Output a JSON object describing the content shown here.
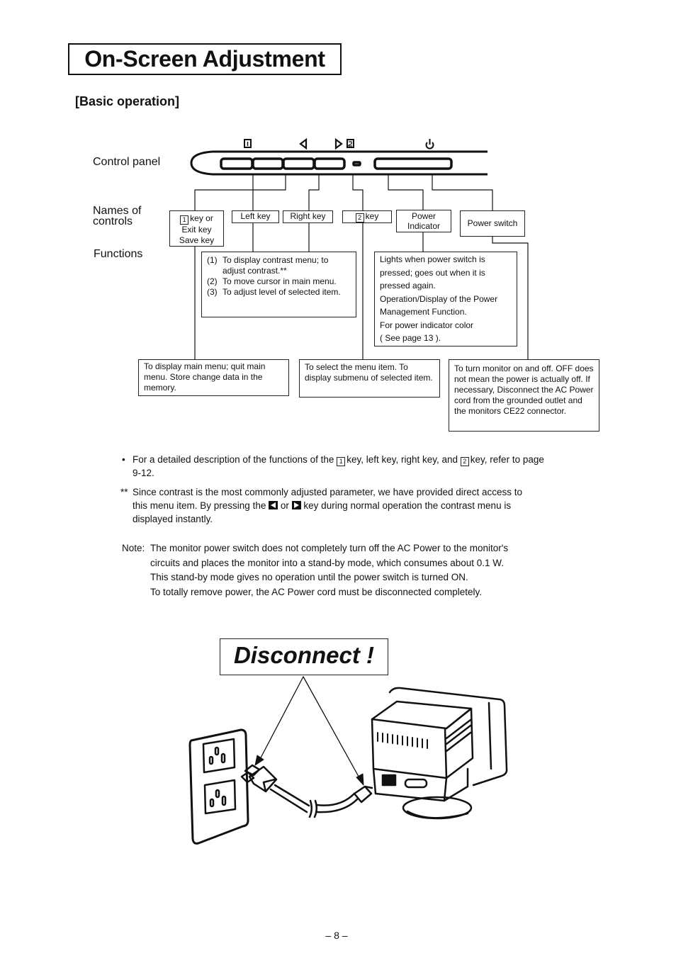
{
  "header": {
    "title": "On-Screen Adjustment",
    "subtitle": "[Basic operation]"
  },
  "diagram": {
    "row_labels": {
      "control_panel": "Control panel",
      "names_of_controls": "Names of controls",
      "names_line1": "Names of",
      "names_line2": "controls",
      "functions": "Functions"
    },
    "panel_icons": [
      {
        "icon": "key-1-icon",
        "glyph": "1"
      },
      {
        "icon": "left-triangle-icon",
        "glyph": "◁"
      },
      {
        "icon": "right-triangle-icon",
        "glyph": "▷"
      },
      {
        "icon": "key-2-icon",
        "glyph": "2"
      },
      {
        "icon": "power-icon",
        "glyph": "⏻"
      }
    ],
    "controls": [
      {
        "name": "1 key or Exit key Save key",
        "key_glyph": "1",
        "line1": "key or",
        "line2": "Exit key",
        "line3": "Save key"
      },
      {
        "name": "Left key"
      },
      {
        "name": "Right key"
      },
      {
        "name": "2 key",
        "key_glyph": "2",
        "suffix": "key"
      },
      {
        "name": "Power Indicator",
        "line1": "Power",
        "line2": "Indicator"
      },
      {
        "name": "Power switch"
      }
    ],
    "functions": {
      "left_right_keys": [
        {
          "num": "(1)",
          "text": "To display contrast menu; to adjust contrast.**"
        },
        {
          "num": "(2)",
          "text": "To move cursor in main menu."
        },
        {
          "num": "(3)",
          "text": "To adjust level of selected item."
        }
      ],
      "power_indicator": [
        "Lights when power switch is",
        "pressed; goes out when it is",
        "pressed again.",
        "Operation/Display of the Power",
        "Management Function.",
        "For power indicator color",
        "( See page 13 )."
      ],
      "key_1": "To display main menu; quit main menu.  Store change data in the memory.",
      "key_2": "To select the menu item. To display submenu of selected item.",
      "power_switch": "To turn monitor on and off. OFF does not mean the power is actually off. If necessary, Disconnect the AC Power cord from the grounded outlet and the monitors CE22 connector."
    }
  },
  "notes": {
    "bullet": {
      "marker": "•",
      "part1": "For a detailed description of the functions of the",
      "key1": "1",
      "part2": "key, left key, right key, and",
      "key2": "2",
      "part3": "key, refer to page 9-12."
    },
    "double_star": {
      "marker": "**",
      "part1": "Since contrast is the most commonly adjusted parameter, we have provided direct access to this menu item. By pressing the",
      "or": "or",
      "part2": "key during normal operation the contrast menu is displayed instantly."
    },
    "note": {
      "label": "Note:",
      "lines": [
        "The monitor power switch does not completely turn off the AC Power to the monitor's",
        "circuits and places the monitor into a stand-by mode, which consumes about 0.1 W.",
        "This stand-by mode gives no operation until the power switch is turned ON.",
        "To totally remove power, the AC Power cord must be disconnected completely."
      ]
    }
  },
  "illustration": {
    "callout": "Disconnect !"
  },
  "footer": {
    "page_number": "– 8 –"
  }
}
